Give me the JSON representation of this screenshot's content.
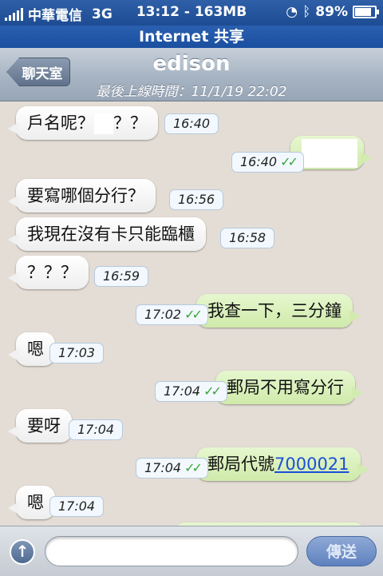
{
  "status_bar": {
    "carrier": "中華電信",
    "network": "3G",
    "time_data": "13:12 - 163MB",
    "battery": "89%",
    "battery_level": 0.89,
    "icons": [
      "signal-icon",
      "clock-icon",
      "bluetooth-icon",
      "battery-icon"
    ]
  },
  "sharing_bar": {
    "label": "Internet 共享"
  },
  "nav": {
    "back_label": "聊天室",
    "title": "edison",
    "subtitle": "最後上線時間：11/1/19 22:02"
  },
  "messages": [
    {
      "dir": "in",
      "text": "戶名呢？",
      "suffix": "？？",
      "redacted": true,
      "time": "16:40"
    },
    {
      "dir": "out",
      "text": "",
      "redacted": true,
      "time": "16:40",
      "delivered": true
    },
    {
      "dir": "in",
      "text": "要寫哪個分行？",
      "time": "16:56"
    },
    {
      "dir": "in",
      "text": "我現在沒有卡只能臨櫃",
      "time": "16:58"
    },
    {
      "dir": "in",
      "text": "？？？",
      "time": "16:59"
    },
    {
      "dir": "out",
      "text": "我查一下，三分鐘",
      "time": "17:02",
      "delivered": true
    },
    {
      "dir": "in",
      "text": "嗯",
      "time": "17:03"
    },
    {
      "dir": "out",
      "text": "郵局不用寫分行",
      "time": "17:04",
      "delivered": true
    },
    {
      "dir": "in",
      "text": "要呀",
      "time": "17:04"
    },
    {
      "dir": "out",
      "text": "郵局代號",
      "link": "7000021",
      "time": "17:04",
      "delivered": true
    },
    {
      "dir": "in",
      "text": "嗯",
      "time": "17:04"
    }
  ],
  "input_bar": {
    "placeholder": "",
    "send_label": "傳送"
  },
  "colors": {
    "status_bg": "#1d4c93",
    "chat_bg": "#e4ddd5",
    "incoming_bubble": "#ffffff",
    "outgoing_bubble": "#d2ebae",
    "check_color": "#3aa63a",
    "link_color": "#1b4fd8"
  }
}
